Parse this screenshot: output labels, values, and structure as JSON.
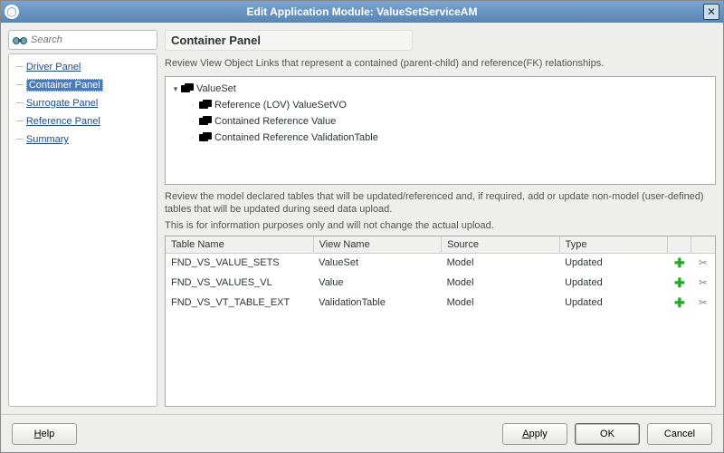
{
  "window": {
    "title": "Edit Application Module: ValueSetServiceAM"
  },
  "search": {
    "placeholder": "Search"
  },
  "nav": {
    "items": [
      {
        "label": "Driver Panel"
      },
      {
        "label": "Container Panel"
      },
      {
        "label": "Surrogate Panel"
      },
      {
        "label": "Reference Panel"
      },
      {
        "label": "Summary"
      }
    ],
    "selected_index": 1
  },
  "panel": {
    "title": "Container Panel",
    "description": "Review View Object Links that represent a contained (parent-child) and reference(FK) relationships.",
    "mid_desc_1": "Review the model declared tables that will be updated/referenced and, if required, add or update non-model (user-defined) tables that will be updated during seed data upload.",
    "mid_desc_2": "This is for information purposes only and will not change the actual upload."
  },
  "tree": [
    {
      "label": "ValueSet",
      "level": 0,
      "expanded": true
    },
    {
      "label": "Reference (LOV) ValueSetVO",
      "level": 1
    },
    {
      "label": "Contained Reference Value",
      "level": 1
    },
    {
      "label": "Contained Reference ValidationTable",
      "level": 1
    }
  ],
  "table": {
    "headers": [
      "Table Name",
      "View Name",
      "Source",
      "Type",
      "",
      ""
    ],
    "rows": [
      {
        "table_name": "FND_VS_VALUE_SETS",
        "view_name": "ValueSet",
        "source": "Model",
        "type": "Updated"
      },
      {
        "table_name": "FND_VS_VALUES_VL",
        "view_name": "Value",
        "source": "Model",
        "type": "Updated"
      },
      {
        "table_name": "FND_VS_VT_TABLE_EXT",
        "view_name": "ValidationTable",
        "source": "Model",
        "type": "Updated"
      }
    ]
  },
  "buttons": {
    "help": "Help",
    "apply": "Apply",
    "ok": "OK",
    "cancel": "Cancel"
  }
}
